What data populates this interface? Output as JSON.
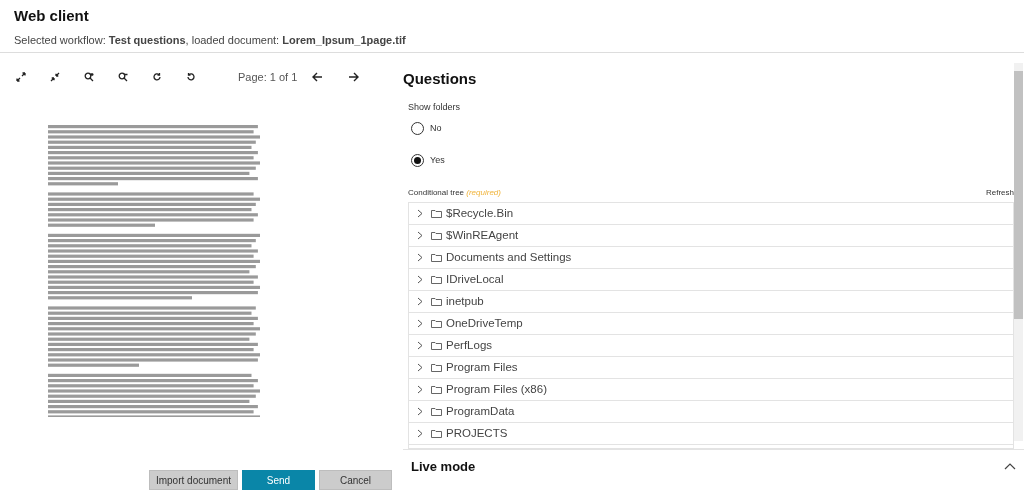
{
  "header": {
    "title": "Web client",
    "subtitle": "Selected workflow: **Test questions**, loaded document: **Lorem_Ipsum_1page.tif**"
  },
  "viewer": {
    "page_label": "Page: 1 of 1"
  },
  "buttons": [
    {
      "label": "Import document",
      "kind": "secondary"
    },
    {
      "label": "Send",
      "kind": "primary"
    },
    {
      "label": "Cancel",
      "kind": "secondary"
    }
  ],
  "questions": {
    "title": "Questions",
    "show_folders": {
      "label": "Show folders",
      "options": [
        {
          "label": "No",
          "selected": false
        },
        {
          "label": "Yes",
          "selected": true
        }
      ]
    },
    "tree": {
      "label": "Conditional tree",
      "required": "(required)",
      "refresh": "Refresh",
      "items": [
        {
          "label": "$Recycle.Bin",
          "expanded": false
        },
        {
          "label": "$WinREAgent",
          "expanded": false
        },
        {
          "label": "Documents and Settings",
          "expanded": false
        },
        {
          "label": "IDriveLocal",
          "expanded": false
        },
        {
          "label": "inetpub",
          "expanded": false
        },
        {
          "label": "OneDriveTemp",
          "expanded": false
        },
        {
          "label": "PerfLogs",
          "expanded": false
        },
        {
          "label": "Program Files",
          "expanded": false
        },
        {
          "label": "Program Files (x86)",
          "expanded": false
        },
        {
          "label": "ProgramData",
          "expanded": false
        },
        {
          "label": "PROJECTS",
          "expanded": false
        }
      ]
    }
  },
  "live_mode": {
    "title": "Live mode"
  }
}
